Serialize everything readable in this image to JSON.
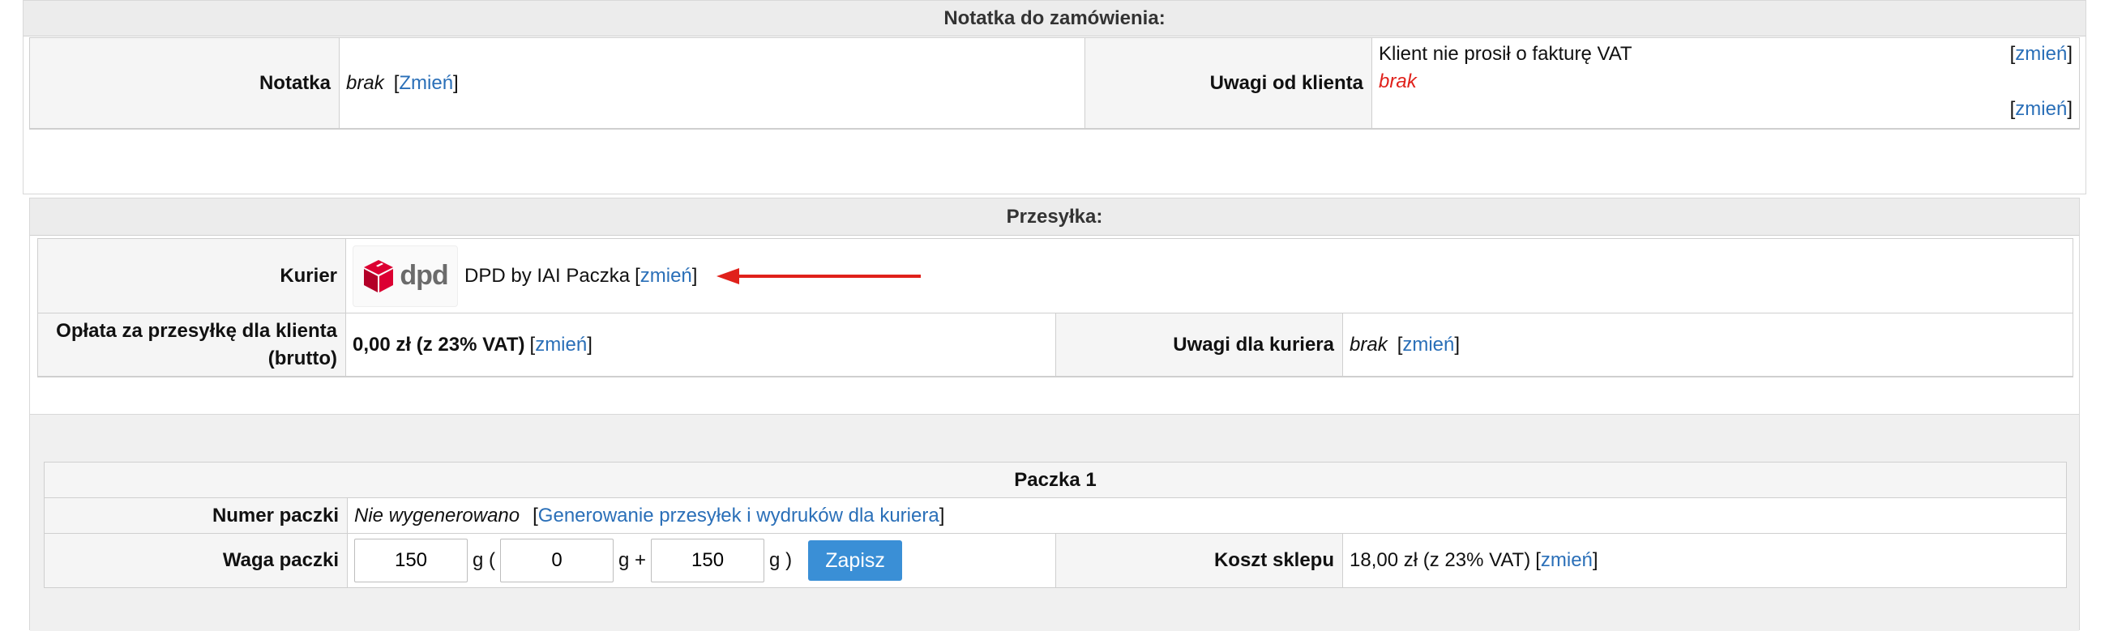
{
  "order_note": {
    "header": "Notatka do zamówienia:",
    "note_label": "Notatka",
    "note_value": "brak",
    "note_link": "Zmień",
    "client_remarks_label": "Uwagi od klienta",
    "client_remarks_text": "Klient nie prosił o fakturę VAT",
    "client_remarks_value": "brak",
    "change_link": "zmień"
  },
  "shipment": {
    "header": "Przesyłka:",
    "courier_label": "Kurier",
    "courier_logo_text": "dpd",
    "courier_name": "DPD by IAI Paczka",
    "courier_change": "zmień",
    "fee_label_line1": "Opłata za przesyłkę dla klienta",
    "fee_label_line2": "(brutto)",
    "fee_value": "0,00 zł (z 23% VAT)",
    "fee_change": "zmień",
    "courier_remarks_label": "Uwagi dla kuriera",
    "courier_remarks_value": "brak",
    "courier_remarks_change": "zmień"
  },
  "package": {
    "header": "Paczka 1",
    "number_label": "Numer paczki",
    "number_value": "Nie wygenerowano",
    "generate_link": "Generowanie przesyłek i wydruków dla kuriera",
    "weight_label": "Waga paczki",
    "weight_total": "150",
    "weight_tare": "0",
    "weight_goods": "150",
    "unit_open": "g (",
    "unit_plus": "g +",
    "unit_close": "g )",
    "save_button": "Zapisz",
    "shop_cost_label": "Koszt sklepu",
    "shop_cost_value": "18,00 zł (z 23% VAT)",
    "shop_cost_change": "zmień"
  },
  "colors": {
    "link": "#2a6fb8",
    "accent_button": "#3a8fd6",
    "arrow": "#e0211b",
    "dpd_red": "#dc0032"
  }
}
